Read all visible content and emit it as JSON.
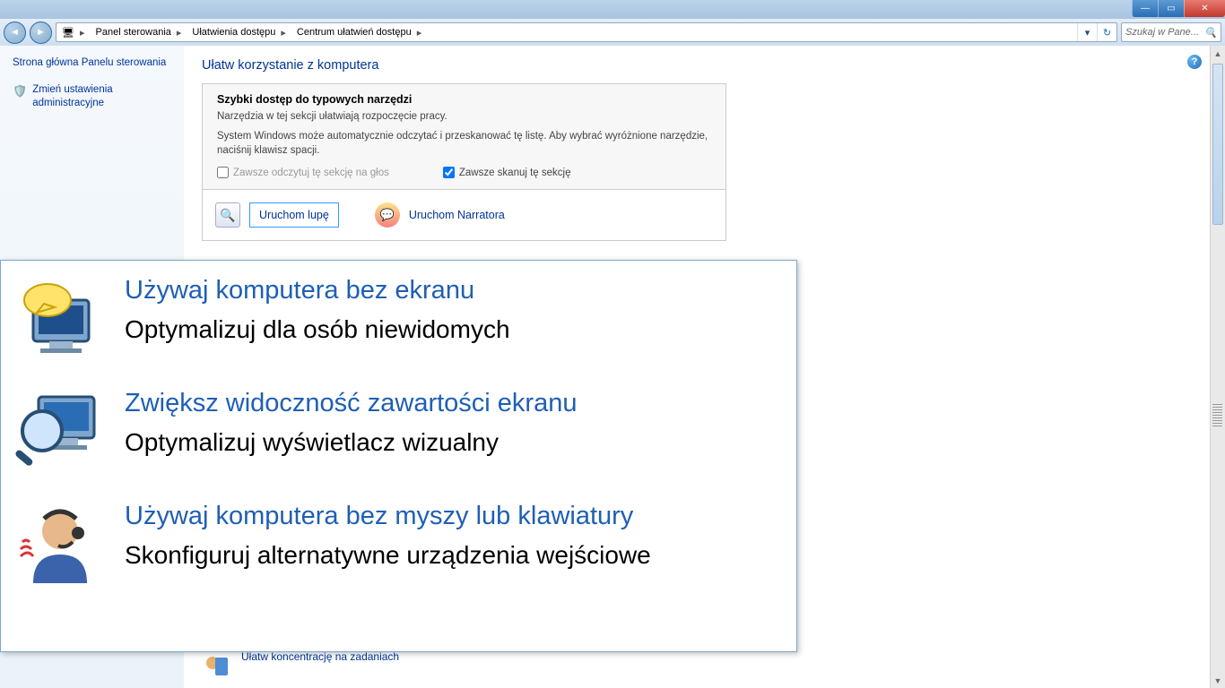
{
  "titlebar": {
    "title": ""
  },
  "addr": {
    "crumb1": "Panel sterowania",
    "crumb2": "Ułatwienia dostępu",
    "crumb3": "Centrum ułatwień dostępu",
    "refresh": "↻",
    "dropdown": "▾",
    "search_placeholder": "Szukaj w Pane..."
  },
  "sidebar": {
    "link1": "Strona główna Panelu sterowania",
    "link2": "Zmień ustawienia administracyjne"
  },
  "page": {
    "title": "Ułatw korzystanie z komputera"
  },
  "box": {
    "title": "Szybki dostęp do typowych narzędzi",
    "desc": "Narzędzia w tej sekcji ułatwiają rozpoczęcie pracy.",
    "note": "System Windows może automatycznie odczytać i przeskanować tę listę. Aby wybrać wyróżnione narzędzie, naciśnij klawisz spacji.",
    "chk1": "Zawsze odczytuj tę sekcję na głos",
    "chk2": "Zawsze skanuj tę sekcję"
  },
  "tools": {
    "magnifier": "Uruchom lupę",
    "narrator": "Uruchom Narratora"
  },
  "bottomlink": {
    "label": "Ułatw koncentrację na zadaniach"
  },
  "overlay": {
    "r1": {
      "title": "Używaj komputera bez ekranu",
      "desc": "Optymalizuj dla osób niewidomych"
    },
    "r2": {
      "title": "Zwiększ widoczność zawartości ekranu",
      "desc": "Optymalizuj wyświetlacz wizualny"
    },
    "r3": {
      "title": "Używaj komputera bez myszy lub klawiatury",
      "desc": "Skonfiguruj alternatywne urządzenia wejściowe"
    }
  }
}
